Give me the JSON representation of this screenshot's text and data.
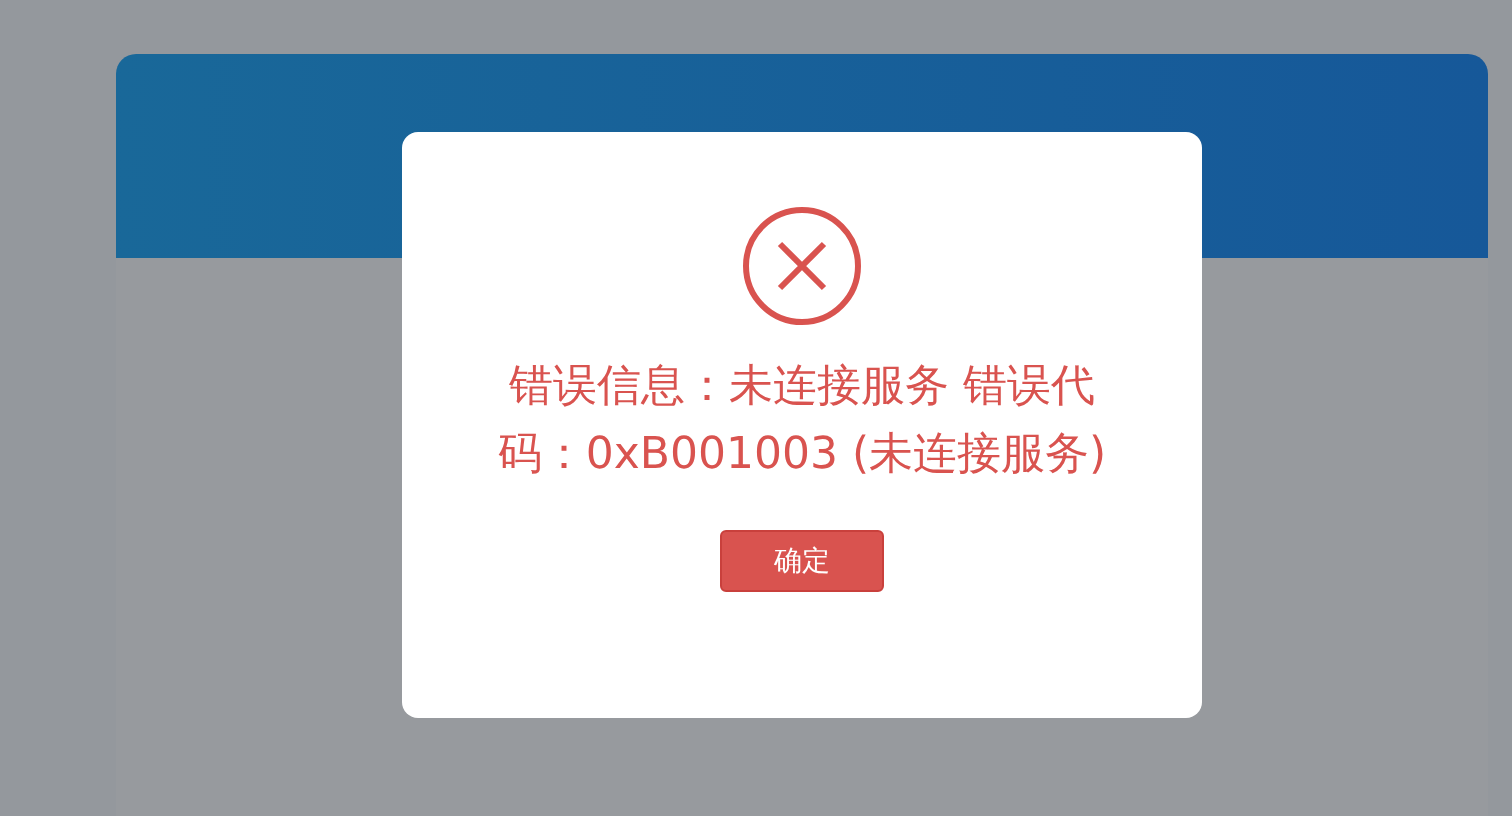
{
  "dialog": {
    "kind": "error",
    "message": "错误信息：未连接服务 错误代码：0xB001003 (未连接服务)",
    "buttons": [
      "确定"
    ]
  }
}
